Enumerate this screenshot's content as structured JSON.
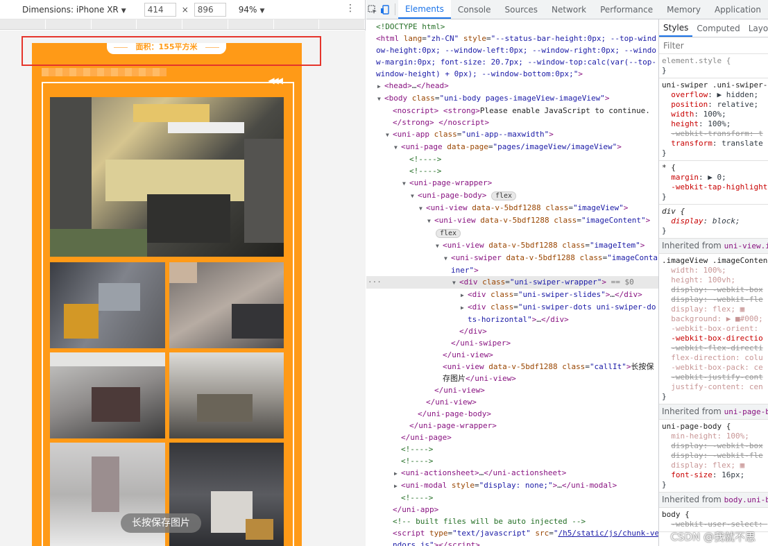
{
  "device_toolbar": {
    "dimensions_label": "Dimensions: iPhone XR",
    "width": "414",
    "x_sep": "×",
    "height": "896",
    "zoom": "94%",
    "more": "⋮"
  },
  "preview": {
    "area_pill": "面积：155平方米",
    "arrows": "◀◀◀",
    "save_button": "长按保存图片"
  },
  "devtools": {
    "tabs": [
      "Elements",
      "Console",
      "Sources",
      "Network",
      "Performance",
      "Memory",
      "Application"
    ],
    "active_tab": "Elements"
  },
  "styles": {
    "tabs": [
      "Styles",
      "Computed",
      "Layo"
    ],
    "filter_placeholder": "Filter",
    "watermark": "CSDN @我就不思"
  }
}
